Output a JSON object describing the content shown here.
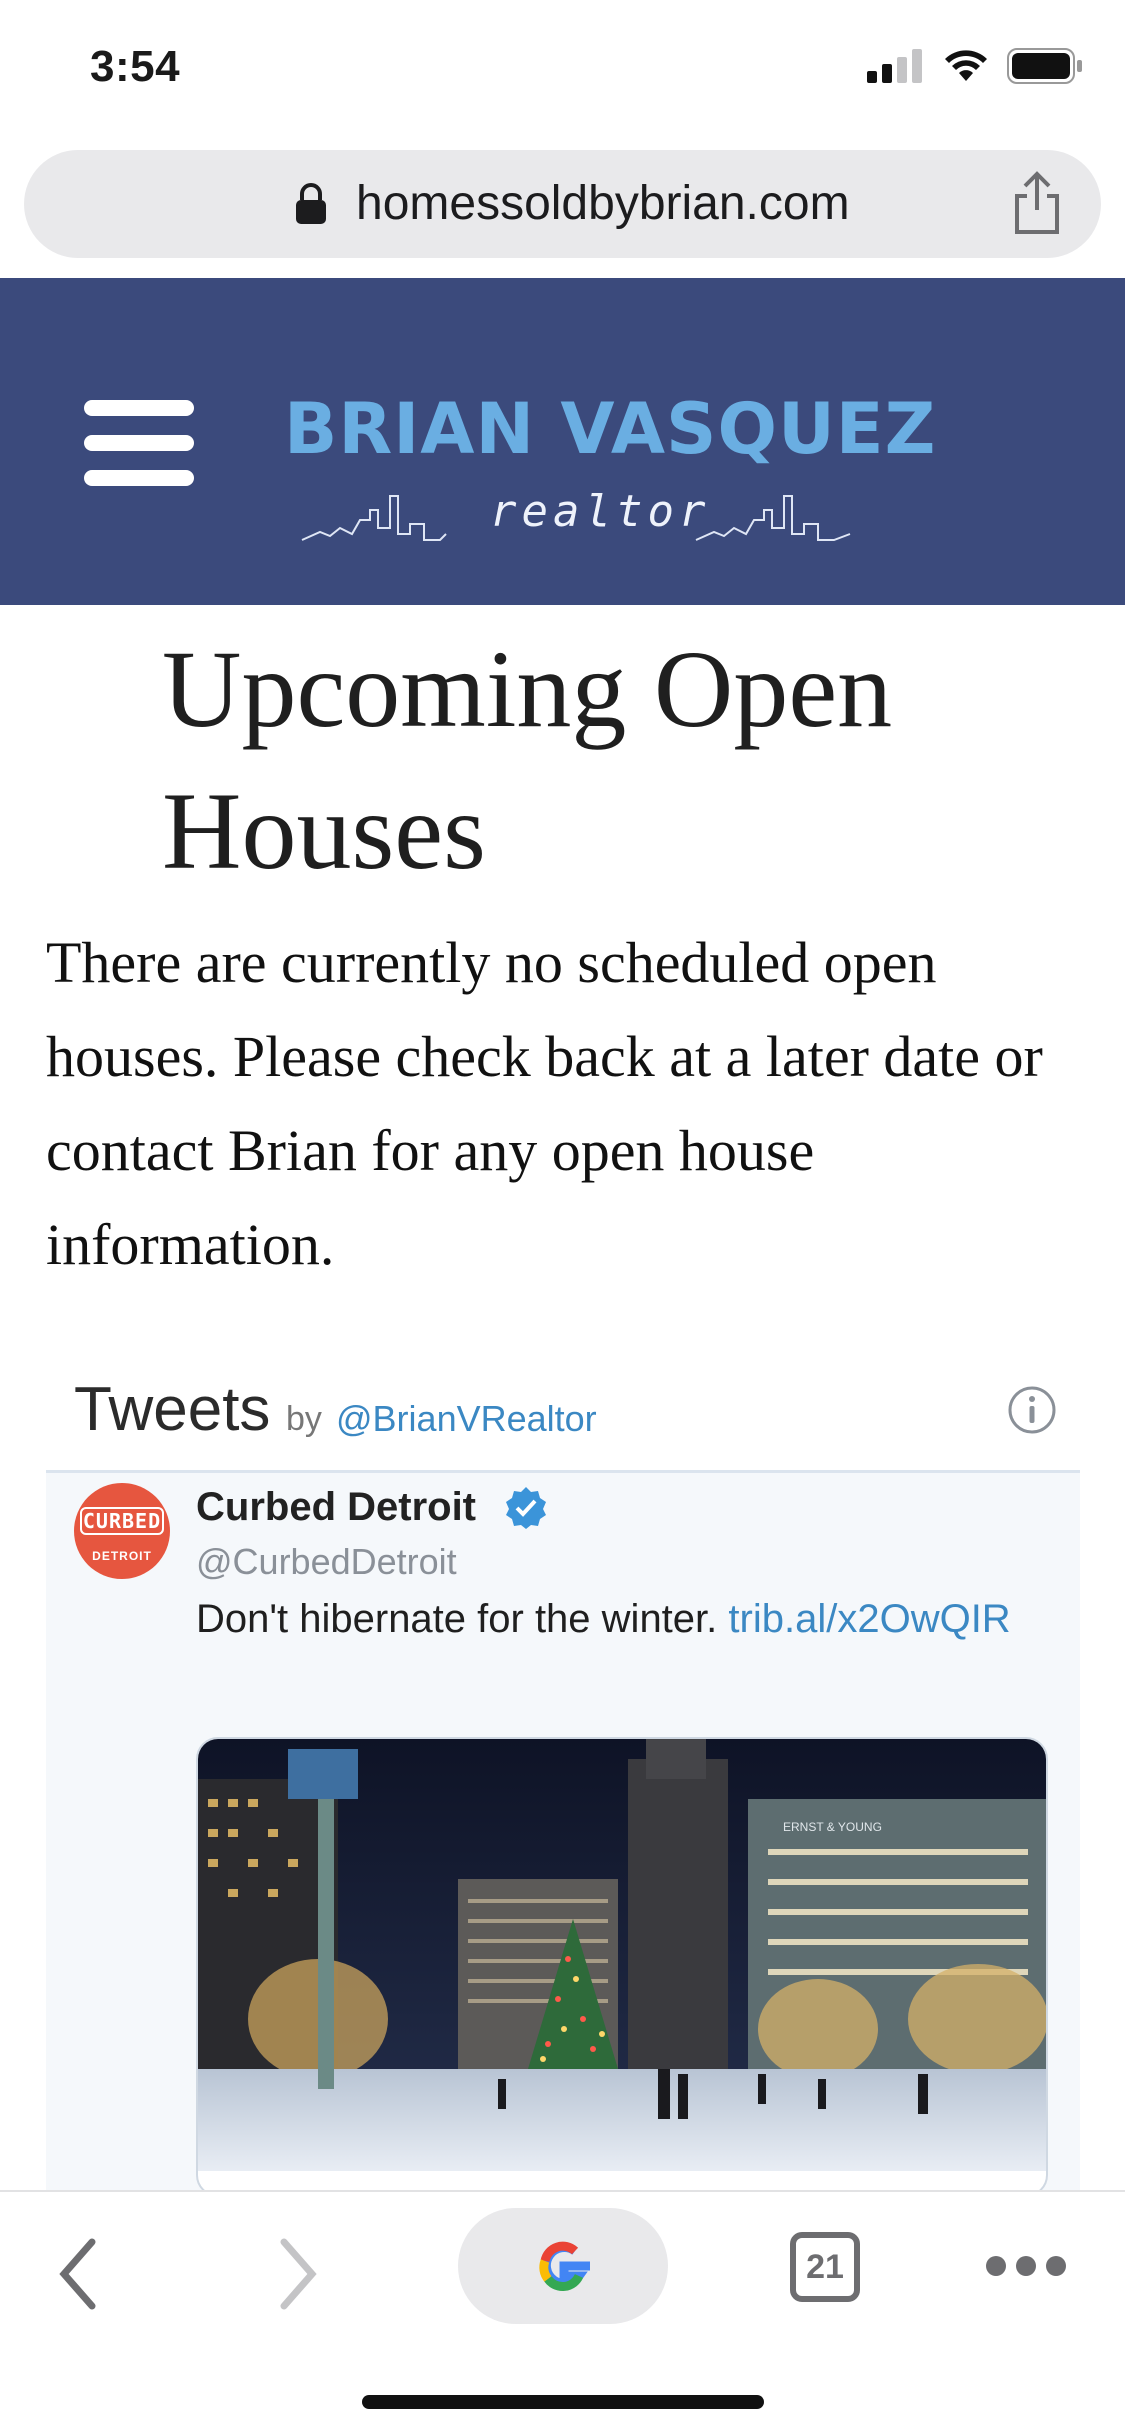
{
  "status_bar": {
    "time": "3:54"
  },
  "browser": {
    "url": "homessoldbybrian.com",
    "tab_count": "21"
  },
  "site": {
    "logo_name": "BRIAN VASQUEZ",
    "logo_subtitle": "realtor",
    "brand_color": "#3b4a7c",
    "logo_color": "#6aaee2"
  },
  "page": {
    "title": "Upcoming Open Houses",
    "intro": "There are currently no scheduled open houses. Please check back at a later date or contact Brian for any open house information."
  },
  "twitter_widget": {
    "title": "Tweets",
    "by_label": "by",
    "handle": "@BrianVRealtor",
    "tweet": {
      "avatar_top": "CURBED",
      "avatar_bottom": "DETROIT",
      "author_name": "Curbed Detroit",
      "author_handle": "@CurbedDetroit",
      "text": "Don't hibernate for the winter.",
      "link": "trib.al/x2OwQIR",
      "image_sign": "ERNST & YOUNG"
    }
  }
}
